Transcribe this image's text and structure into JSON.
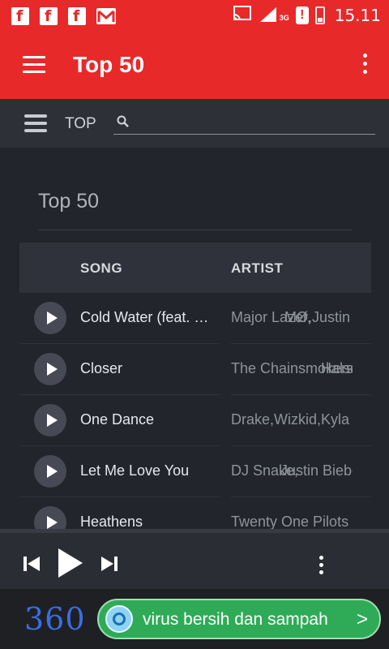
{
  "status_bar": {
    "time": "15.11",
    "network": "3G",
    "notification_icons": [
      "facebook-icon",
      "facebook-icon",
      "facebook-icon",
      "gmail-icon"
    ],
    "alert": "!"
  },
  "app_bar": {
    "title": "Top 50",
    "background": "#e8292a"
  },
  "toolbar": {
    "label": "TOP",
    "search_value": "",
    "search_placeholder": ""
  },
  "main": {
    "section_title": "Top 50",
    "columns": [
      "SONG",
      "ARTIST"
    ],
    "tracks": [
      {
        "song": "Cold Water (feat. Justin Bieber & MØ)",
        "artist": "Major Lazer,",
        "artist_overlap": "MØ,Justin Bieber"
      },
      {
        "song": "Closer",
        "artist": "The Chainsmokers,",
        "artist_overlap": "Halsey"
      },
      {
        "song": "One Dance",
        "artist": "Drake,Wizkid,Kyla",
        "artist_overlap": ""
      },
      {
        "song": "Let Me Love You",
        "artist": "DJ Snake,",
        "artist_overlap": "Justin Bieber"
      },
      {
        "song": "Heathens",
        "artist": "Twenty One Pilots",
        "artist_overlap": ""
      }
    ]
  },
  "ad": {
    "logo": "360",
    "text": "virus bersih dan sampah",
    "arrow": ">"
  }
}
